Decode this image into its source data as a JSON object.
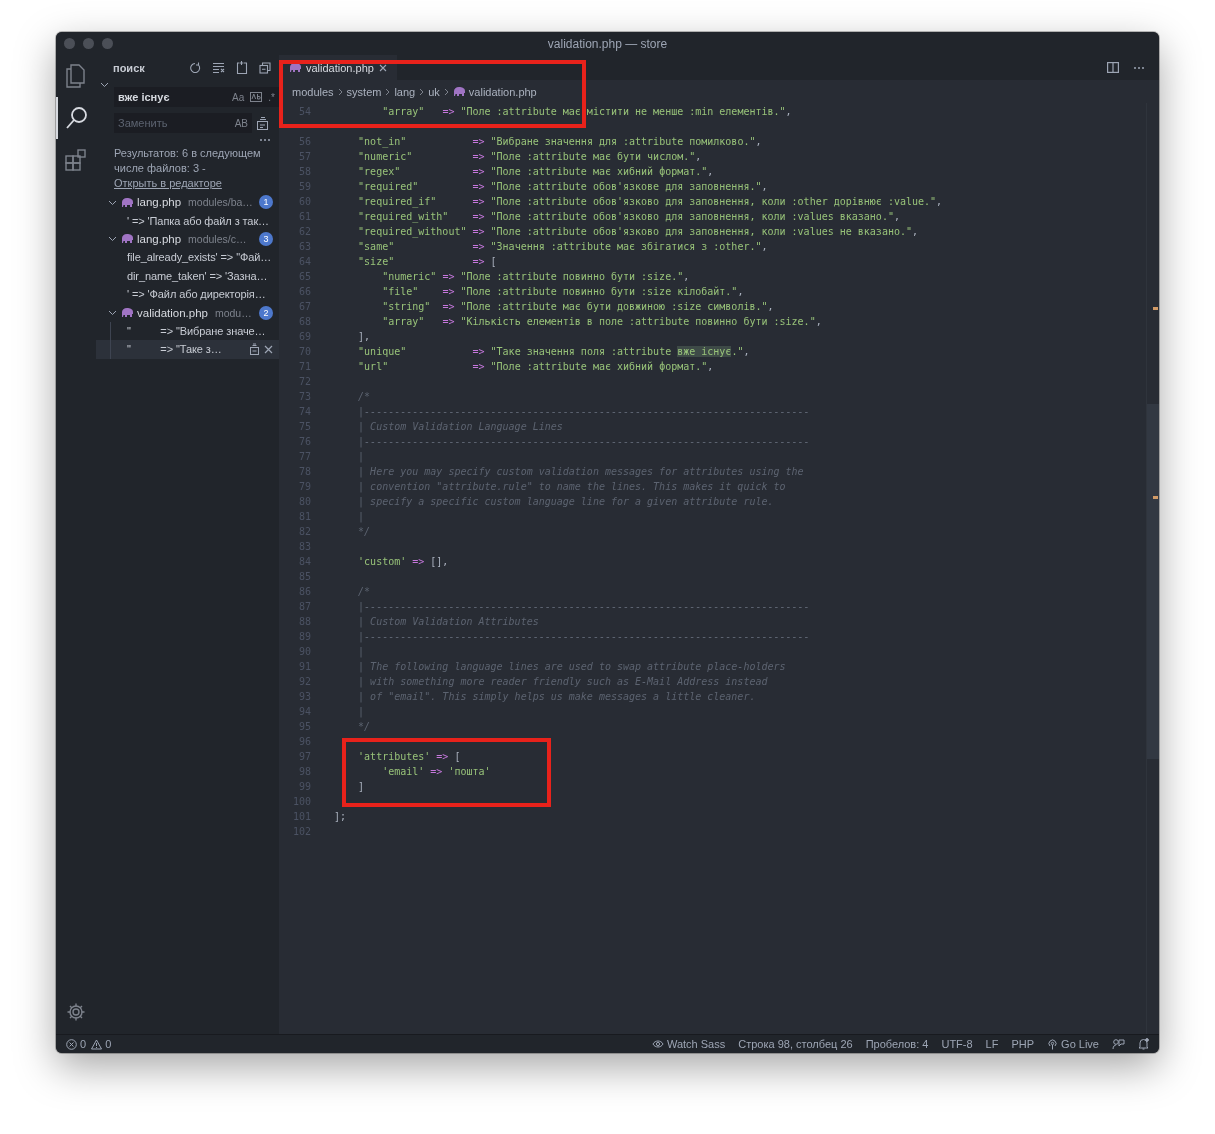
{
  "window": {
    "title": "validation.php — store"
  },
  "activity_bar": {
    "items": [
      {
        "kind": "files",
        "selected": false
      },
      {
        "kind": "search",
        "selected": true
      },
      {
        "kind": "extensions",
        "selected": false
      }
    ]
  },
  "search": {
    "title": "поиск",
    "query": "вже існує",
    "match_case": "Aa",
    "use_regex": ".*",
    "replace_placeholder": "Заменить",
    "preserve_case": "AB",
    "summary": "Результатов: 6 в следующем числе файлов: 3 - ",
    "open_link": "Открыть в редакторе",
    "results": [
      {
        "file": "lang.php",
        "path": "modules/ba…",
        "count": "1",
        "expanded": true,
        "matches": [
          {
            "text": "' => 'Папка або файл з так…",
            "selected": false
          }
        ]
      },
      {
        "file": "lang.php",
        "path": "modules/c…",
        "count": "3",
        "expanded": true,
        "matches": [
          {
            "text": "file_already_exists' => \"Фай…",
            "selected": false
          },
          {
            "text": "dir_name_taken' => 'Зазна…",
            "selected": false
          },
          {
            "text": "' => 'Файл або директорія…",
            "selected": false
          }
        ]
      },
      {
        "file": "validation.php",
        "path": "modu…",
        "count": "2",
        "expanded": true,
        "matches": [
          {
            "text": "\"          => \"Вибране значе…",
            "selected": false
          },
          {
            "text": "\"          => \"Таке з…",
            "selected": true
          }
        ]
      }
    ]
  },
  "editor": {
    "tabs": [
      {
        "label": "validation.php",
        "selected": true
      }
    ],
    "breadcrumbs": [
      "modules",
      "system",
      "lang",
      "uk",
      "validation.php"
    ],
    "lines": [
      {
        "n": "54",
        "segs": [
          {
            "kind": "str",
            "text": "        \"array\"   "
          },
          {
            "kind": "op",
            "text": "=>"
          },
          {
            "kind": "str",
            "text": " \"Поле :attribute має містити не менше :min елементів.\""
          },
          {
            "kind": "punct",
            "text": ","
          }
        ]
      },
      {
        "n": "56",
        "segs": [
          {
            "kind": "str",
            "text": "    \"not_in\"           "
          },
          {
            "kind": "op",
            "text": "=>"
          },
          {
            "kind": "str",
            "text": " \"Вибране значення для :attribute помилково.\""
          },
          {
            "kind": "punct",
            "text": ","
          }
        ]
      },
      {
        "n": "57",
        "segs": [
          {
            "kind": "str",
            "text": "    \"numeric\"          "
          },
          {
            "kind": "op",
            "text": "=>"
          },
          {
            "kind": "str",
            "text": " \"Поле :attribute має бути числом.\""
          },
          {
            "kind": "punct",
            "text": ","
          }
        ]
      },
      {
        "n": "58",
        "segs": [
          {
            "kind": "str",
            "text": "    \"regex\"            "
          },
          {
            "kind": "op",
            "text": "=>"
          },
          {
            "kind": "str",
            "text": " \"Поле :attribute має хибний формат.\""
          },
          {
            "kind": "punct",
            "text": ","
          }
        ]
      },
      {
        "n": "59",
        "segs": [
          {
            "kind": "str",
            "text": "    \"required\"         "
          },
          {
            "kind": "op",
            "text": "=>"
          },
          {
            "kind": "str",
            "text": " \"Поле :attribute обов'язкове для заповнення.\""
          },
          {
            "kind": "punct",
            "text": ","
          }
        ]
      },
      {
        "n": "60",
        "segs": [
          {
            "kind": "str",
            "text": "    \"required_if\"      "
          },
          {
            "kind": "op",
            "text": "=>"
          },
          {
            "kind": "str",
            "text": " \"Поле :attribute обов'язково для заповнення, коли :other дорівнює :value.\""
          },
          {
            "kind": "punct",
            "text": ","
          }
        ]
      },
      {
        "n": "61",
        "segs": [
          {
            "kind": "str",
            "text": "    \"required_with\"    "
          },
          {
            "kind": "op",
            "text": "=>"
          },
          {
            "kind": "str",
            "text": " \"Поле :attribute обов'язково для заповнення, коли :values вказано.\""
          },
          {
            "kind": "punct",
            "text": ","
          }
        ]
      },
      {
        "n": "62",
        "segs": [
          {
            "kind": "str",
            "text": "    \"required_without\" "
          },
          {
            "kind": "op",
            "text": "=>"
          },
          {
            "kind": "str",
            "text": " \"Поле :attribute обов'язково для заповнення, коли :values не вказано.\""
          },
          {
            "kind": "punct",
            "text": ","
          }
        ]
      },
      {
        "n": "63",
        "segs": [
          {
            "kind": "str",
            "text": "    \"same\"             "
          },
          {
            "kind": "op",
            "text": "=>"
          },
          {
            "kind": "str",
            "text": " \"Значення :attribute має збігатися з :other.\""
          },
          {
            "kind": "punct",
            "text": ","
          }
        ]
      },
      {
        "n": "64",
        "segs": [
          {
            "kind": "str",
            "text": "    \"size\"             "
          },
          {
            "kind": "op",
            "text": "=>"
          },
          {
            "kind": "punct",
            "text": " ["
          }
        ]
      },
      {
        "n": "65",
        "segs": [
          {
            "kind": "str",
            "text": "        \"numeric\" "
          },
          {
            "kind": "op",
            "text": "=>"
          },
          {
            "kind": "str",
            "text": " \"Поле :attribute повинно бути :size.\""
          },
          {
            "kind": "punct",
            "text": ","
          }
        ]
      },
      {
        "n": "66",
        "segs": [
          {
            "kind": "str",
            "text": "        \"file\"    "
          },
          {
            "kind": "op",
            "text": "=>"
          },
          {
            "kind": "str",
            "text": " \"Поле :attribute повинно бути :size кілобайт.\""
          },
          {
            "kind": "punct",
            "text": ","
          }
        ]
      },
      {
        "n": "67",
        "segs": [
          {
            "kind": "str",
            "text": "        \"string\"  "
          },
          {
            "kind": "op",
            "text": "=>"
          },
          {
            "kind": "str",
            "text": " \"Поле :attribute має бути довжиною :size символів.\""
          },
          {
            "kind": "punct",
            "text": ","
          }
        ]
      },
      {
        "n": "68",
        "segs": [
          {
            "kind": "str",
            "text": "        \"array\"   "
          },
          {
            "kind": "op",
            "text": "=>"
          },
          {
            "kind": "str",
            "text": " \"Кількість елементів в поле :attribute повинно бути :size.\""
          },
          {
            "kind": "punct",
            "text": ","
          }
        ]
      },
      {
        "n": "69",
        "segs": [
          {
            "kind": "punct",
            "text": "    ],"
          }
        ]
      },
      {
        "n": "70",
        "segs": [
          {
            "kind": "str",
            "text": "    \"unique\"           "
          },
          {
            "kind": "op",
            "text": "=>"
          },
          {
            "kind": "str",
            "text": " \"Таке значення поля :attribute "
          },
          {
            "kind": "match",
            "text": "вже існує"
          },
          {
            "kind": "str",
            "text": ".\""
          },
          {
            "kind": "punct",
            "text": ","
          }
        ]
      },
      {
        "n": "71",
        "segs": [
          {
            "kind": "str",
            "text": "    \"url\"              "
          },
          {
            "kind": "op",
            "text": "=>"
          },
          {
            "kind": "str",
            "text": " \"Поле :attribute має хибний формат.\""
          },
          {
            "kind": "punct",
            "text": ","
          }
        ]
      },
      {
        "n": "72"
      },
      {
        "n": "73",
        "segs": [
          {
            "kind": "comment",
            "text": "    /*"
          }
        ]
      },
      {
        "n": "74",
        "segs": [
          {
            "kind": "comment",
            "text": "    |--------------------------------------------------------------------------"
          }
        ]
      },
      {
        "n": "75",
        "segs": [
          {
            "kind": "comment",
            "text": "    | Custom Validation Language Lines"
          }
        ]
      },
      {
        "n": "76",
        "segs": [
          {
            "kind": "comment",
            "text": "    |--------------------------------------------------------------------------"
          }
        ]
      },
      {
        "n": "77",
        "segs": [
          {
            "kind": "comment",
            "text": "    |"
          }
        ]
      },
      {
        "n": "78",
        "segs": [
          {
            "kind": "comment",
            "text": "    | Here you may specify custom validation messages for attributes using the"
          }
        ]
      },
      {
        "n": "79",
        "segs": [
          {
            "kind": "comment",
            "text": "    | convention \"attribute.rule\" to name the lines. This makes it quick to"
          }
        ]
      },
      {
        "n": "80",
        "segs": [
          {
            "kind": "comment",
            "text": "    | specify a specific custom language line for a given attribute rule."
          }
        ]
      },
      {
        "n": "81",
        "segs": [
          {
            "kind": "comment",
            "text": "    |"
          }
        ]
      },
      {
        "n": "82",
        "segs": [
          {
            "kind": "comment",
            "text": "    */"
          }
        ]
      },
      {
        "n": "83"
      },
      {
        "n": "84",
        "segs": [
          {
            "kind": "str",
            "text": "    'custom'"
          },
          {
            "kind": "op",
            "text": " =>"
          },
          {
            "kind": "punct",
            "text": " [],"
          }
        ]
      },
      {
        "n": "85"
      },
      {
        "n": "86",
        "segs": [
          {
            "kind": "comment",
            "text": "    /*"
          }
        ]
      },
      {
        "n": "87",
        "segs": [
          {
            "kind": "comment",
            "text": "    |--------------------------------------------------------------------------"
          }
        ]
      },
      {
        "n": "88",
        "segs": [
          {
            "kind": "comment",
            "text": "    | Custom Validation Attributes"
          }
        ]
      },
      {
        "n": "89",
        "segs": [
          {
            "kind": "comment",
            "text": "    |--------------------------------------------------------------------------"
          }
        ]
      },
      {
        "n": "90",
        "segs": [
          {
            "kind": "comment",
            "text": "    |"
          }
        ]
      },
      {
        "n": "91",
        "segs": [
          {
            "kind": "comment",
            "text": "    | The following language lines are used to swap attribute place-holders"
          }
        ]
      },
      {
        "n": "92",
        "segs": [
          {
            "kind": "comment",
            "text": "    | with something more reader friendly such as E-Mail Address instead"
          }
        ]
      },
      {
        "n": "93",
        "segs": [
          {
            "kind": "comment",
            "text": "    | of \"email\". This simply helps us make messages a little cleaner."
          }
        ]
      },
      {
        "n": "94",
        "segs": [
          {
            "kind": "comment",
            "text": "    |"
          }
        ]
      },
      {
        "n": "95",
        "segs": [
          {
            "kind": "comment",
            "text": "    */"
          }
        ]
      },
      {
        "n": "96"
      },
      {
        "n": "97",
        "segs": [
          {
            "kind": "str",
            "text": "    'attributes'"
          },
          {
            "kind": "op",
            "text": " =>"
          },
          {
            "kind": "punct",
            "text": " ["
          }
        ]
      },
      {
        "n": "98",
        "segs": [
          {
            "kind": "str",
            "text": "        'email'"
          },
          {
            "kind": "op",
            "text": " =>"
          },
          {
            "kind": "str",
            "text": " 'пошта'"
          }
        ]
      },
      {
        "n": "99",
        "segs": [
          {
            "kind": "punct",
            "text": "    ]"
          }
        ]
      },
      {
        "n": "100"
      },
      {
        "n": "101",
        "segs": [
          {
            "kind": "punct",
            "text": "];"
          }
        ]
      },
      {
        "n": "102"
      }
    ]
  },
  "status_bar": {
    "left": [
      {
        "kind": "errors",
        "text": "0"
      },
      {
        "kind": "warnings",
        "text": "0"
      }
    ],
    "right": [
      {
        "kind": "eye",
        "text": "Watch Sass"
      },
      {
        "kind": "plain",
        "text": "Строка 98, столбец 26"
      },
      {
        "kind": "plain",
        "text": "Пробелов: 4"
      },
      {
        "kind": "plain",
        "text": "UTF-8"
      },
      {
        "kind": "plain",
        "text": "LF"
      },
      {
        "kind": "plain",
        "text": "PHP"
      },
      {
        "kind": "broadcast",
        "text": "Go Live"
      },
      {
        "kind": "feedback"
      },
      {
        "kind": "bell"
      }
    ]
  }
}
